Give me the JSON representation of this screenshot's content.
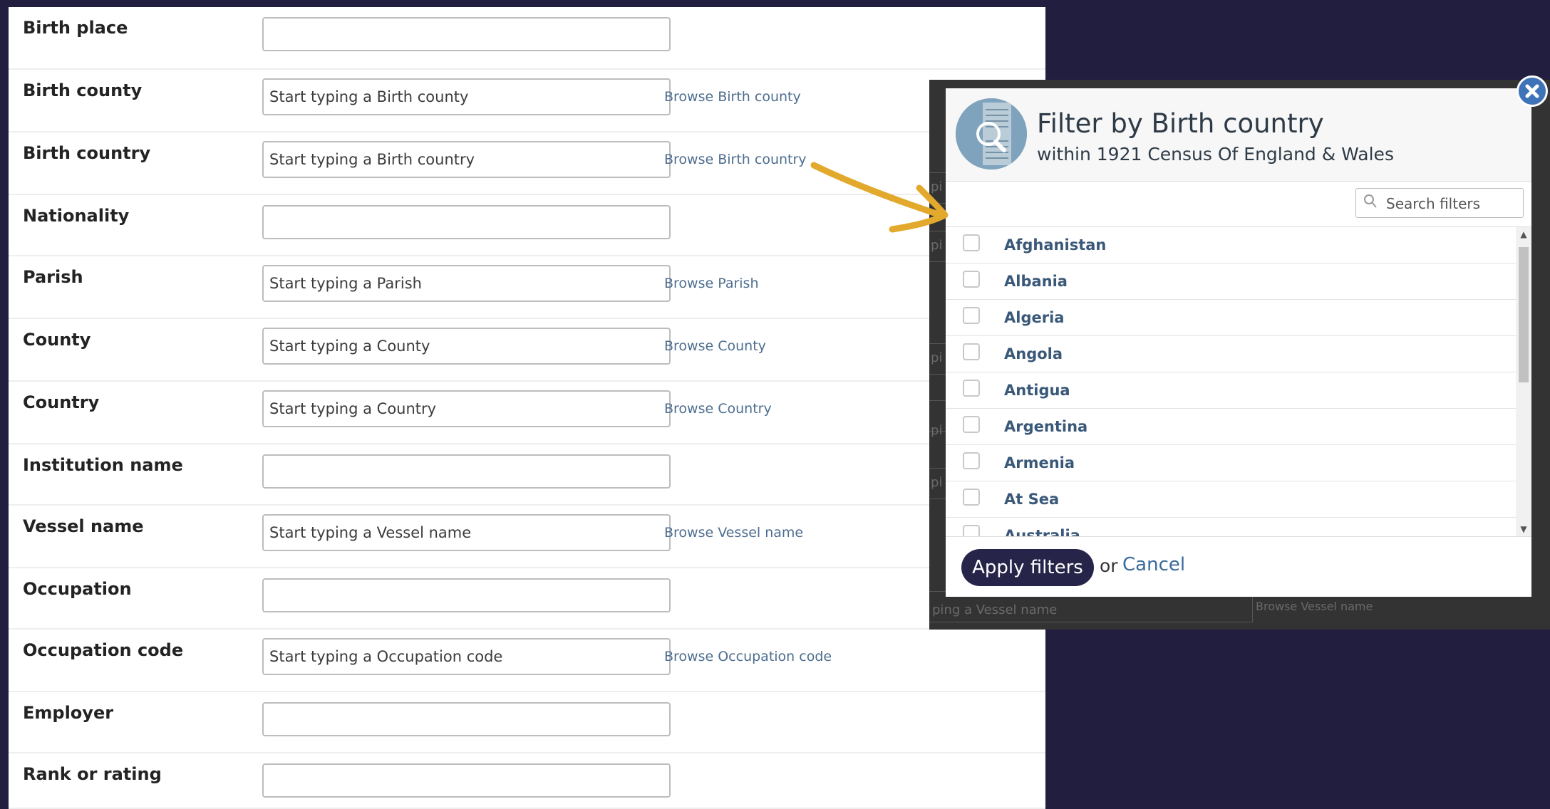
{
  "form": {
    "rows": [
      {
        "label": "Birth place",
        "placeholder": "",
        "browse": ""
      },
      {
        "label": "Birth county",
        "placeholder": "Start typing a Birth county",
        "browse": "Browse Birth county"
      },
      {
        "label": "Birth country",
        "placeholder": "Start typing a Birth country",
        "browse": "Browse Birth country"
      },
      {
        "label": "Nationality",
        "placeholder": "",
        "browse": ""
      },
      {
        "label": "Parish",
        "placeholder": "Start typing a Parish",
        "browse": "Browse Parish"
      },
      {
        "label": "County",
        "placeholder": "Start typing a County",
        "browse": "Browse County"
      },
      {
        "label": "Country",
        "placeholder": "Start typing a Country",
        "browse": "Browse Country"
      },
      {
        "label": "Institution name",
        "placeholder": "",
        "browse": ""
      },
      {
        "label": "Vessel name",
        "placeholder": "Start typing a Vessel name",
        "browse": "Browse Vessel name"
      },
      {
        "label": "Occupation",
        "placeholder": "",
        "browse": ""
      },
      {
        "label": "Occupation code",
        "placeholder": "Start typing a Occupation code",
        "browse": "Browse Occupation code"
      },
      {
        "label": "Employer",
        "placeholder": "",
        "browse": ""
      },
      {
        "label": "Rank or rating",
        "placeholder": "",
        "browse": ""
      }
    ]
  },
  "background_ghost": {
    "vessel_placeholder": "ping a Vessel name",
    "vessel_browse": "Browse Vessel name",
    "cut_fragment": "pi"
  },
  "modal": {
    "title": "Filter by Birth country",
    "subtitle": "within 1921 Census Of England & Wales",
    "search_placeholder": "Search filters",
    "options": [
      "Afghanistan",
      "Albania",
      "Algeria",
      "Angola",
      "Antigua",
      "Argentina",
      "Armenia",
      "At Sea",
      "Australia"
    ],
    "apply_label": "Apply filters",
    "or_text": "or",
    "cancel_label": "Cancel",
    "close_icon": "close-icon",
    "search_icon": "search-icon"
  },
  "colors": {
    "page_background": "#211e40",
    "arrow": "#e2a92c",
    "apply_button": "#272449",
    "link": "#4d6d8f"
  }
}
